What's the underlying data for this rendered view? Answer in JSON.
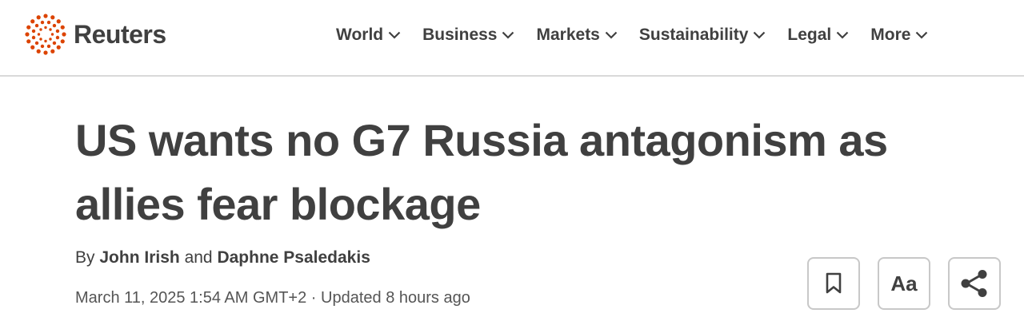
{
  "brand": {
    "name": "Reuters",
    "logo_icon": "reuters-dots-logo-icon",
    "accent": "#dc4300"
  },
  "nav": {
    "items": [
      {
        "label": "World",
        "icon": "chevron-down-icon"
      },
      {
        "label": "Business",
        "icon": "chevron-down-icon"
      },
      {
        "label": "Markets",
        "icon": "chevron-down-icon"
      },
      {
        "label": "Sustainability",
        "icon": "chevron-down-icon"
      },
      {
        "label": "Legal",
        "icon": "chevron-down-icon"
      },
      {
        "label": "More",
        "icon": "chevron-down-icon"
      }
    ]
  },
  "article": {
    "headline": "US wants no G7 Russia antagonism as allies fear blockage",
    "byline": {
      "prefix": "By",
      "author1": "John Irish",
      "conjunction": "and",
      "author2": "Daphne Psaledakis"
    },
    "published": "March 11, 2025 1:54 AM GMT+2",
    "separator": "·",
    "updated": "Updated 8 hours ago"
  },
  "actions": {
    "bookmark_icon": "bookmark-icon",
    "text_size_label": "Aa",
    "share_icon": "share-icon"
  }
}
